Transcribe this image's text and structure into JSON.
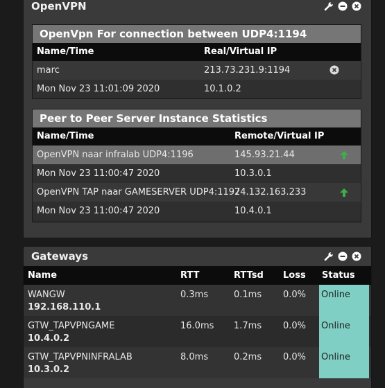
{
  "openvpn": {
    "title": "OpenVPN",
    "connection_section": {
      "title": "OpenVpn For connection between UDP4:1194",
      "col_name": "Name/Time",
      "col_ip": "Real/Virtual IP",
      "rows": [
        {
          "name": "marc",
          "ip": "213.73.231.9:1194"
        },
        {
          "name": "Mon Nov 23 11:01:09 2020",
          "ip": "10.1.0.2"
        }
      ]
    },
    "peer_section": {
      "title": "Peer to Peer Server Instance Statistics",
      "col_name": "Name/Time",
      "col_ip": "Remote/Virtual IP",
      "rows": [
        {
          "name": "OpenVPN naar infralab UDP4:1196",
          "ip": "145.93.21.44"
        },
        {
          "name": "Mon Nov 23 11:00:47 2020",
          "ip": "10.3.0.1"
        },
        {
          "name": "OpenVPN TAP naar GAMESERVER UDP4:1197",
          "ip": "24.132.163.233"
        },
        {
          "name": "Mon Nov 23 11:00:47 2020",
          "ip": "10.4.0.1"
        }
      ]
    }
  },
  "gateways": {
    "title": "Gateways",
    "headers": {
      "name": "Name",
      "rtt": "RTT",
      "rttsd": "RTTsd",
      "loss": "Loss",
      "status": "Status"
    },
    "rows": [
      {
        "name": "WANGW",
        "ip": "192.168.110.1",
        "rtt": "0.3ms",
        "rttsd": "0.1ms",
        "loss": "0.0%",
        "status": "Online"
      },
      {
        "name": "GTW_TAPVPNGAME",
        "ip": "10.4.0.2",
        "rtt": "16.0ms",
        "rttsd": "1.7ms",
        "loss": "0.0%",
        "status": "Online"
      },
      {
        "name": "GTW_TAPVPNINFRALAB",
        "ip": "10.3.0.2",
        "rtt": "8.0ms",
        "rttsd": "0.2ms",
        "loss": "0.0%",
        "status": "Online"
      }
    ]
  },
  "colors": {
    "status_online": "#7fcfc4",
    "up_arrow": "#3fae49"
  }
}
